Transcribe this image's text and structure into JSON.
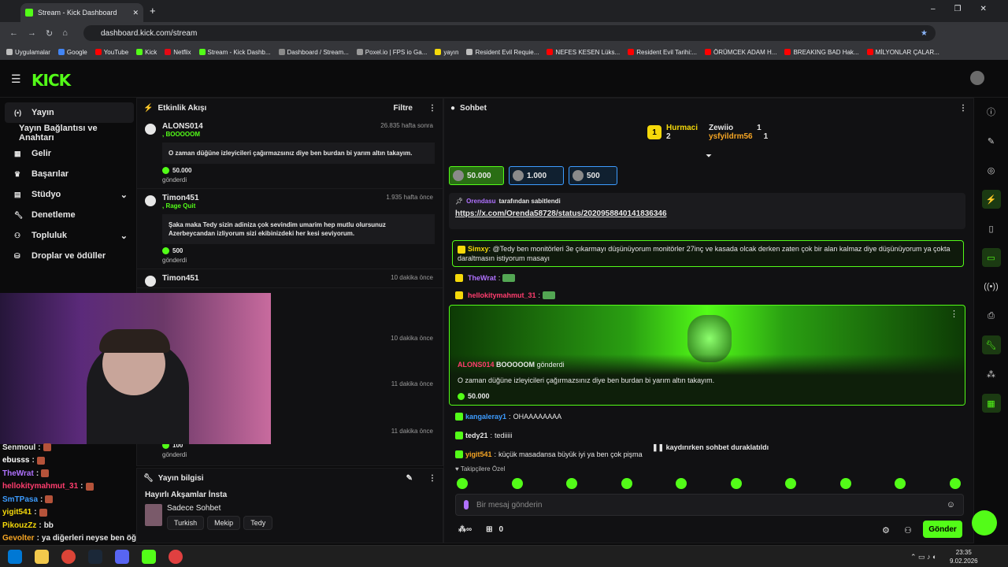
{
  "browser": {
    "tab_title": "Stream - Kick Dashboard",
    "url": "dashboard.kick.com/stream",
    "bookmarks": [
      "Uygulamalar",
      "Google",
      "YouTube",
      "Kick",
      "Netflix",
      "Stream - Kick Dashb...",
      "Dashboard / Stream...",
      "Poxel.io | FPS io Ga...",
      "yayın",
      "Resident Evil Requie...",
      "NEFES KESEN Lüks...",
      "Resident Evil Tarihi:...",
      "ÖRÜMCEK ADAM H...",
      "BREAKING BAD Hak...",
      "MİLYONLAR ÇALAR..."
    ]
  },
  "logo": "KICK",
  "nav": {
    "items": [
      "Yayın",
      "Yayın Bağlantısı ve Anahtarı",
      "Gelir",
      "Başarılar",
      "Stüdyo",
      "Denetleme",
      "Topluluk",
      "Droplar ve ödüller"
    ]
  },
  "events": {
    "title": "Etkinlik Akışı",
    "filter": "Filtre",
    "list": [
      {
        "name": "ALONS014",
        "time": "26.835 hafta sonra",
        "sub": ", BOOOOOM",
        "msg": "O zaman düğüne izleyicileri çağırmazsınız diye ben burdan bi yarım altın takayım.",
        "amount": "50.000",
        "sent": "gönderdi"
      },
      {
        "name": "Timon451",
        "time": "1.935 hafta önce",
        "sub": ", Rage Quit",
        "msg": "Şaka maka Tedy sizin adiniza çok sevindim umarim hep mutlu olursunuz Azerbeycandan izliyorum sizi ekibinizdeki her kesi seviyorum.",
        "amount": "500",
        "sent": "gönderdi"
      },
      {
        "name": "Timon451",
        "time": "10 dakika önce"
      }
    ],
    "times_extra": [
      "10 dakika önce",
      "11 dakika önce",
      "11 dakika önce"
    ],
    "last_amount": "100",
    "last_sent": "gönderdi"
  },
  "info": {
    "title": "Yayın bilgisi",
    "stream_title": "Hayırlı Akşamlar İnsta",
    "category": "Sadece Sohbet",
    "tags": [
      "Turkish",
      "Mekip",
      "Tedy"
    ]
  },
  "chat": {
    "title": "Sohbet",
    "leaderboard": {
      "first": {
        "name": "Hurmaci",
        "count": "2"
      },
      "second": {
        "name": "Zewiio",
        "count": "1"
      },
      "third": {
        "name": "ysfyildrm56",
        "count": "1"
      }
    },
    "gifts": [
      "50.000",
      "1.000",
      "500"
    ],
    "pinned": {
      "by": "Orendasu",
      "label": "tarafından sabitlendi",
      "link": "https://x.com/Orenda58728/status/2020958840141836346"
    },
    "messages": [
      {
        "user": "Simxy",
        "color": "#f5d90a",
        "text": "@Tedy ben monitörleri 3e çıkarmayı düşünüyorum monitörler 27inç ve kasada olcak derken zaten çok bir alan kalmaz diye düşünüyorum ya çokta daraltmasın istiyorum masayı"
      },
      {
        "user": "TheWrat",
        "color": "#b072ff",
        "text": ""
      },
      {
        "user": "hellokitymahmut_31",
        "color": "#ff3d6e",
        "text": ""
      }
    ],
    "highlight": {
      "user": "ALONS014",
      "gift": "BOOOOOM",
      "sent": "gönderdi",
      "text": "O zaman düğüne izleyicileri çağırmazsınız diye ben burdan bi yarım altın takayım.",
      "amount": "50.000"
    },
    "after": [
      {
        "user": "kangaleray1",
        "color": "#3d9cff",
        "text": "OHAAAAAAAA"
      },
      {
        "user": "tedy21",
        "color": "#e7e7e7",
        "text": "tediiiii"
      },
      {
        "user": "yigit541",
        "color": "#f5a524",
        "text": "küçük masadansa büyük iyi ya ben çok pişma"
      }
    ],
    "paused": "kaydırırken sohbet duraklatıldı",
    "followers_label": "Takipçilere Özel",
    "input_placeholder": "Bir mesaj gönderin",
    "points": "0",
    "send": "Gönder"
  },
  "webcam_chat": [
    {
      "user": "Senmoul",
      "text": ""
    },
    {
      "user": "ebusss",
      "text": "",
      "color": "#ffffff"
    },
    {
      "user": "TheWrat",
      "text": "",
      "color": "#b072ff"
    },
    {
      "user": "hellokitymahmut_31",
      "text": "",
      "color": "#ff3d6e"
    },
    {
      "user": "SmTPasa",
      "text": "",
      "color": "#3d9cff"
    },
    {
      "user": "yigit541",
      "text": "",
      "color": "#f5d90a"
    },
    {
      "user": "PikouzZz",
      "text": "bb",
      "color": "#f5d90a"
    },
    {
      "user": "Gevolter",
      "text": "ya diğerleri neyse ben öğrenciyim",
      "color": "#f5a524"
    }
  ],
  "taskbar": {
    "time": "23:35",
    "date": "9.02.2026"
  },
  "colors": {
    "accent": "#53fc18",
    "bg": "#0b0b0c",
    "panel": "#111113"
  }
}
